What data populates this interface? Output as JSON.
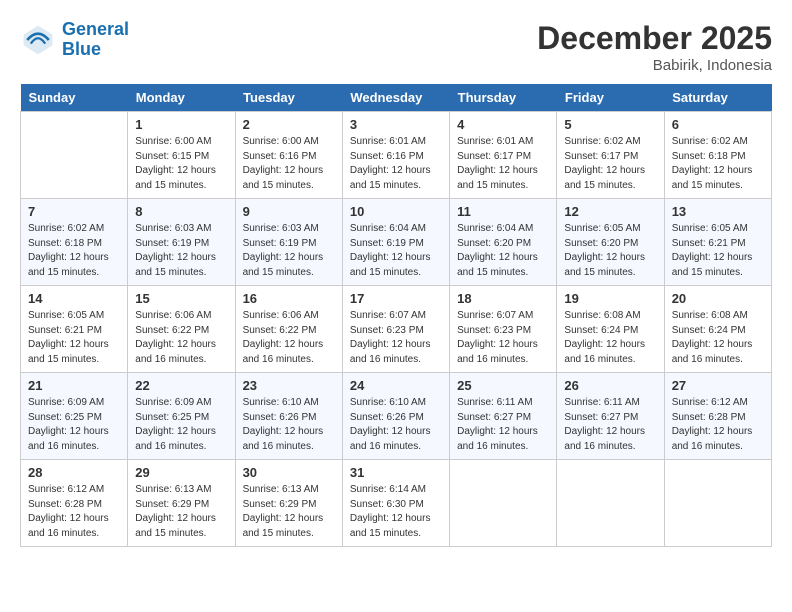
{
  "header": {
    "logo_line1": "General",
    "logo_line2": "Blue",
    "month": "December 2025",
    "location": "Babirik, Indonesia"
  },
  "weekdays": [
    "Sunday",
    "Monday",
    "Tuesday",
    "Wednesday",
    "Thursday",
    "Friday",
    "Saturday"
  ],
  "weeks": [
    [
      {
        "day": "",
        "info": ""
      },
      {
        "day": "1",
        "info": "Sunrise: 6:00 AM\nSunset: 6:15 PM\nDaylight: 12 hours\nand 15 minutes."
      },
      {
        "day": "2",
        "info": "Sunrise: 6:00 AM\nSunset: 6:16 PM\nDaylight: 12 hours\nand 15 minutes."
      },
      {
        "day": "3",
        "info": "Sunrise: 6:01 AM\nSunset: 6:16 PM\nDaylight: 12 hours\nand 15 minutes."
      },
      {
        "day": "4",
        "info": "Sunrise: 6:01 AM\nSunset: 6:17 PM\nDaylight: 12 hours\nand 15 minutes."
      },
      {
        "day": "5",
        "info": "Sunrise: 6:02 AM\nSunset: 6:17 PM\nDaylight: 12 hours\nand 15 minutes."
      },
      {
        "day": "6",
        "info": "Sunrise: 6:02 AM\nSunset: 6:18 PM\nDaylight: 12 hours\nand 15 minutes."
      }
    ],
    [
      {
        "day": "7",
        "info": "Sunrise: 6:02 AM\nSunset: 6:18 PM\nDaylight: 12 hours\nand 15 minutes."
      },
      {
        "day": "8",
        "info": "Sunrise: 6:03 AM\nSunset: 6:19 PM\nDaylight: 12 hours\nand 15 minutes."
      },
      {
        "day": "9",
        "info": "Sunrise: 6:03 AM\nSunset: 6:19 PM\nDaylight: 12 hours\nand 15 minutes."
      },
      {
        "day": "10",
        "info": "Sunrise: 6:04 AM\nSunset: 6:19 PM\nDaylight: 12 hours\nand 15 minutes."
      },
      {
        "day": "11",
        "info": "Sunrise: 6:04 AM\nSunset: 6:20 PM\nDaylight: 12 hours\nand 15 minutes."
      },
      {
        "day": "12",
        "info": "Sunrise: 6:05 AM\nSunset: 6:20 PM\nDaylight: 12 hours\nand 15 minutes."
      },
      {
        "day": "13",
        "info": "Sunrise: 6:05 AM\nSunset: 6:21 PM\nDaylight: 12 hours\nand 15 minutes."
      }
    ],
    [
      {
        "day": "14",
        "info": "Sunrise: 6:05 AM\nSunset: 6:21 PM\nDaylight: 12 hours\nand 15 minutes."
      },
      {
        "day": "15",
        "info": "Sunrise: 6:06 AM\nSunset: 6:22 PM\nDaylight: 12 hours\nand 16 minutes."
      },
      {
        "day": "16",
        "info": "Sunrise: 6:06 AM\nSunset: 6:22 PM\nDaylight: 12 hours\nand 16 minutes."
      },
      {
        "day": "17",
        "info": "Sunrise: 6:07 AM\nSunset: 6:23 PM\nDaylight: 12 hours\nand 16 minutes."
      },
      {
        "day": "18",
        "info": "Sunrise: 6:07 AM\nSunset: 6:23 PM\nDaylight: 12 hours\nand 16 minutes."
      },
      {
        "day": "19",
        "info": "Sunrise: 6:08 AM\nSunset: 6:24 PM\nDaylight: 12 hours\nand 16 minutes."
      },
      {
        "day": "20",
        "info": "Sunrise: 6:08 AM\nSunset: 6:24 PM\nDaylight: 12 hours\nand 16 minutes."
      }
    ],
    [
      {
        "day": "21",
        "info": "Sunrise: 6:09 AM\nSunset: 6:25 PM\nDaylight: 12 hours\nand 16 minutes."
      },
      {
        "day": "22",
        "info": "Sunrise: 6:09 AM\nSunset: 6:25 PM\nDaylight: 12 hours\nand 16 minutes."
      },
      {
        "day": "23",
        "info": "Sunrise: 6:10 AM\nSunset: 6:26 PM\nDaylight: 12 hours\nand 16 minutes."
      },
      {
        "day": "24",
        "info": "Sunrise: 6:10 AM\nSunset: 6:26 PM\nDaylight: 12 hours\nand 16 minutes."
      },
      {
        "day": "25",
        "info": "Sunrise: 6:11 AM\nSunset: 6:27 PM\nDaylight: 12 hours\nand 16 minutes."
      },
      {
        "day": "26",
        "info": "Sunrise: 6:11 AM\nSunset: 6:27 PM\nDaylight: 12 hours\nand 16 minutes."
      },
      {
        "day": "27",
        "info": "Sunrise: 6:12 AM\nSunset: 6:28 PM\nDaylight: 12 hours\nand 16 minutes."
      }
    ],
    [
      {
        "day": "28",
        "info": "Sunrise: 6:12 AM\nSunset: 6:28 PM\nDaylight: 12 hours\nand 16 minutes."
      },
      {
        "day": "29",
        "info": "Sunrise: 6:13 AM\nSunset: 6:29 PM\nDaylight: 12 hours\nand 15 minutes."
      },
      {
        "day": "30",
        "info": "Sunrise: 6:13 AM\nSunset: 6:29 PM\nDaylight: 12 hours\nand 15 minutes."
      },
      {
        "day": "31",
        "info": "Sunrise: 6:14 AM\nSunset: 6:30 PM\nDaylight: 12 hours\nand 15 minutes."
      },
      {
        "day": "",
        "info": ""
      },
      {
        "day": "",
        "info": ""
      },
      {
        "day": "",
        "info": ""
      }
    ]
  ]
}
